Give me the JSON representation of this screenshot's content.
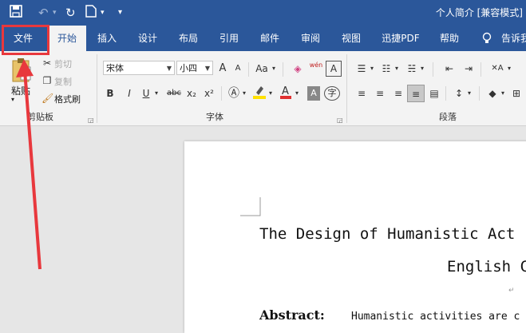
{
  "title_bar": {
    "document_title": "个人简介 [兼容模式]",
    "quick_access": {
      "save_icon": "save-icon",
      "undo_icon": "undo-icon",
      "redo_icon": "redo-icon",
      "new_doc_icon": "new-document-icon",
      "customize_icon": "customize-qat-icon"
    }
  },
  "tabs": [
    {
      "label": "文件"
    },
    {
      "label": "开始"
    },
    {
      "label": "插入"
    },
    {
      "label": "设计"
    },
    {
      "label": "布局"
    },
    {
      "label": "引用"
    },
    {
      "label": "邮件"
    },
    {
      "label": "审阅"
    },
    {
      "label": "视图"
    },
    {
      "label": "迅捷PDF"
    },
    {
      "label": "帮助"
    },
    {
      "label": "告诉我"
    }
  ],
  "active_tab": "开始",
  "clipboard": {
    "group_label": "剪贴板",
    "paste_label": "粘贴",
    "cut_label": "剪切",
    "copy_label": "复制",
    "format_painter_label": "格式刷"
  },
  "font": {
    "group_label": "字体",
    "font_name": "宋体",
    "font_size": "小四",
    "grow_label": "A",
    "shrink_label": "A",
    "case_label": "Aa",
    "phonetic_label": "wén",
    "bold": "B",
    "italic": "I",
    "underline": "U",
    "strike": "abc",
    "subscript": "x₂",
    "superscript": "x²",
    "enclosed_char": "字"
  },
  "paragraph": {
    "group_label": "段落"
  },
  "document": {
    "title_line": "The Design of Humanistic Act",
    "subtitle_line": "English C",
    "abstract_label": "Abstract:",
    "abstract_text": "Humanistic activities are c"
  },
  "colors": {
    "ribbon_blue": "#2b579a",
    "annotation_red": "#e8383d",
    "font_color_red": "#e03030",
    "highlight_yellow": "#ffe100"
  }
}
